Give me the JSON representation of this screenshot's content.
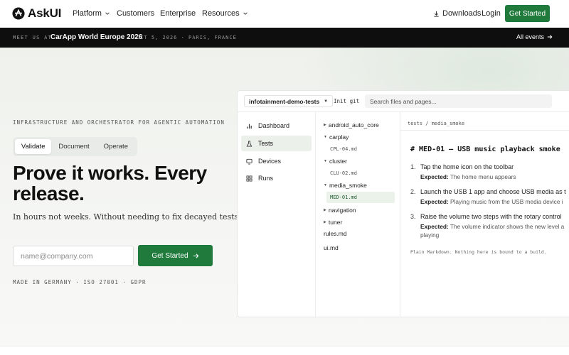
{
  "nav": {
    "logo_text": "AskUI",
    "items": [
      "Platform",
      "Customers",
      "Enterprise",
      "Resources"
    ],
    "downloads": "Downloads",
    "login": "Login",
    "cta": "Get Started"
  },
  "announce": {
    "meet": "MEET US AT",
    "event": "CarApp World Europe 2026",
    "date": "OCT 5, 2026 · PARIS, FRANCE",
    "all_events": "All events"
  },
  "hero": {
    "eyebrow": "INFRASTRUCTURE AND ORCHESTRATOR FOR AGENTIC AUTOMATION",
    "tabs": [
      "Validate",
      "Document",
      "Operate"
    ],
    "active_tab": "Validate",
    "headline_line1": "Prove it works. Every",
    "headline_line2": "release.",
    "subtitle": "In hours not weeks. Without needing to fix decayed tests.",
    "email_placeholder": "name@company.com",
    "cta": "Get Started",
    "footnote": "MADE IN GERMANY · ISO 27001 · GDPR"
  },
  "app": {
    "repo": "infotainment-demo-tests",
    "init_git": "Init git",
    "search_placeholder": "Search files and pages...",
    "sidebar": [
      {
        "label": "Dashboard",
        "icon": "bar-chart-icon"
      },
      {
        "label": "Tests",
        "icon": "flask-icon",
        "active": true
      },
      {
        "label": "Devices",
        "icon": "monitor-icon"
      },
      {
        "label": "Runs",
        "icon": "grid-icon"
      }
    ],
    "tree": {
      "android_auto_core": "android_auto_core",
      "carplay": "carplay",
      "carplay_file": "CPL-04.md",
      "cluster": "cluster",
      "cluster_file": "CLU-02.md",
      "media_smoke": "media_smoke",
      "media_file": "MED-01.md",
      "navigation": "navigation",
      "tuner": "tuner",
      "rules": "rules.md",
      "ui": "ui.md"
    },
    "doc": {
      "breadcrumb": "tests / media_smoke",
      "title": "# MED-01 — USB music playback smoke",
      "expected_label": "Expected:",
      "steps": [
        {
          "num": "1.",
          "text": "Tap the home icon on the toolbar",
          "expected": "The home menu appears"
        },
        {
          "num": "2.",
          "text": "Launch the USB 1 app and choose USB media as t",
          "expected": "Playing music from the USB media device i"
        },
        {
          "num": "3.",
          "text": "Raise the volume two steps with the rotary control",
          "expected": "The volume indicator shows the new level a",
          "expected_cont": "playing"
        }
      ],
      "note": "Plain Markdown. Nothing here is bound to a build."
    }
  },
  "colors": {
    "accent": "#1f7a3c",
    "announce_bg": "#0e0e0e",
    "active_nav_bg": "#ebf0ea"
  }
}
